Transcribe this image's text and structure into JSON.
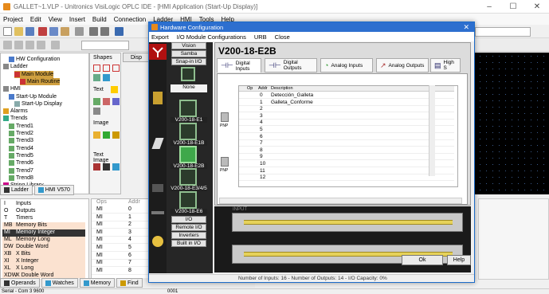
{
  "app": {
    "title": "GALLET~1.VLP - Unitronics VisiLogic OPLC IDE - [HMI Application (Start-Up Display)]",
    "menu": [
      "Project",
      "Edit",
      "View",
      "Insert",
      "Build",
      "Connection",
      "Ladder",
      "HMI",
      "Tools",
      "Help"
    ]
  },
  "tree": {
    "items": [
      {
        "label": "HW Configuration",
        "indent": 1
      },
      {
        "label": "Ladder",
        "indent": 0
      },
      {
        "label": "Main Module",
        "indent": 2
      },
      {
        "label": "Main Routine",
        "indent": 3
      },
      {
        "label": "HMI",
        "indent": 0
      },
      {
        "label": "Start-Up Module",
        "indent": 1
      },
      {
        "label": "Start-Up Display",
        "indent": 2
      },
      {
        "label": "Alarms",
        "indent": 0
      },
      {
        "label": "Trends",
        "indent": 0
      },
      {
        "label": "Trend1",
        "indent": 1
      },
      {
        "label": "Trend2",
        "indent": 1
      },
      {
        "label": "Trend3",
        "indent": 1
      },
      {
        "label": "Trend4",
        "indent": 1
      },
      {
        "label": "Trend5",
        "indent": 1
      },
      {
        "label": "Trend6",
        "indent": 1
      },
      {
        "label": "Trend7",
        "indent": 1
      },
      {
        "label": "Trend8",
        "indent": 1
      },
      {
        "label": "String Library",
        "indent": 0
      }
    ],
    "tabs": [
      "Ladder",
      "HMI V570"
    ]
  },
  "shapes": {
    "title": "Shapes",
    "text": "Text",
    "image": "Image",
    "text_image": "Text Image"
  },
  "disp_tab": "Disp",
  "operands": {
    "items": [
      {
        "abbr": "I",
        "name": "Inputs"
      },
      {
        "abbr": "O",
        "name": "Outputs"
      },
      {
        "abbr": "T",
        "name": "Timers"
      },
      {
        "abbr": "MB",
        "name": "Memory Bits"
      },
      {
        "abbr": "MI",
        "name": "Memory Integer"
      },
      {
        "abbr": "ML",
        "name": "Memory Long"
      },
      {
        "abbr": "DW",
        "name": "Double Word"
      },
      {
        "abbr": "XB",
        "name": "X Bits"
      },
      {
        "abbr": "XI",
        "name": "X Integer"
      },
      {
        "abbr": "XL",
        "name": "X Long"
      },
      {
        "abbr": "XDW",
        "name": "X Double Word"
      }
    ],
    "table_headers": [
      "Ops",
      "Addr"
    ],
    "rows": [
      {
        "op": "MI",
        "addr": "0"
      },
      {
        "op": "MI",
        "addr": "1"
      },
      {
        "op": "MI",
        "addr": "2"
      },
      {
        "op": "MI",
        "addr": "3"
      },
      {
        "op": "MI",
        "addr": "4"
      },
      {
        "op": "MI",
        "addr": "5"
      },
      {
        "op": "MI",
        "addr": "6"
      },
      {
        "op": "MI",
        "addr": "7"
      },
      {
        "op": "MI",
        "addr": "8"
      }
    ]
  },
  "bottom_tabs": [
    "Operands",
    "Watches",
    "Memory",
    "Find"
  ],
  "status": {
    "port": "Serial - Com 3  9600",
    "code": "0001"
  },
  "dialog": {
    "title": "Hardware Configuration",
    "menu": [
      "Export",
      "I/O Module Configurations",
      "URB",
      "Close"
    ],
    "side_buttons": [
      "Vision",
      "Samba",
      "Snap-in I/O"
    ],
    "modules": [
      "None",
      "V200-18-E1",
      "V200-18-E1B",
      "V200-18-E2B",
      "V200-18-E3/4/5",
      "V200-18-E6"
    ],
    "lower_buttons": [
      "I/O Expansions",
      "Remote I/O",
      "Inverters",
      "Built in I/O"
    ],
    "model_name": "V200-18-E2B",
    "io_tabs": [
      "Digital Inputs",
      "Digital Outputs",
      "Analog Inputs",
      "Analog Outputs",
      "High S"
    ],
    "io_headers": [
      "Op",
      "Addr",
      "Description"
    ],
    "io_rows": [
      {
        "addr": "0",
        "desc": "Detección_Galleta"
      },
      {
        "addr": "1",
        "desc": "Galleta_Conforme"
      },
      {
        "addr": "2",
        "desc": ""
      },
      {
        "addr": "3",
        "desc": ""
      },
      {
        "addr": "4",
        "desc": ""
      },
      {
        "addr": "5",
        "desc": ""
      },
      {
        "addr": "6",
        "desc": ""
      },
      {
        "addr": "7",
        "desc": ""
      },
      {
        "addr": "8",
        "desc": ""
      },
      {
        "addr": "9",
        "desc": ""
      },
      {
        "addr": "10",
        "desc": ""
      },
      {
        "addr": "11",
        "desc": ""
      },
      {
        "addr": "12",
        "desc": ""
      }
    ],
    "pnp_label": "PNP",
    "ok": "Ok",
    "help": "Help",
    "status": "Number of Inputs: 16  -  Number of Outputs: 14  -  I/O Capacity: 0%",
    "plate_label": "INPUT"
  },
  "colors": {
    "accent": "#2d6fcf",
    "selected": "#d0a040",
    "operand_highlight": "#fbe2d0",
    "strip": "#e6d25a"
  }
}
